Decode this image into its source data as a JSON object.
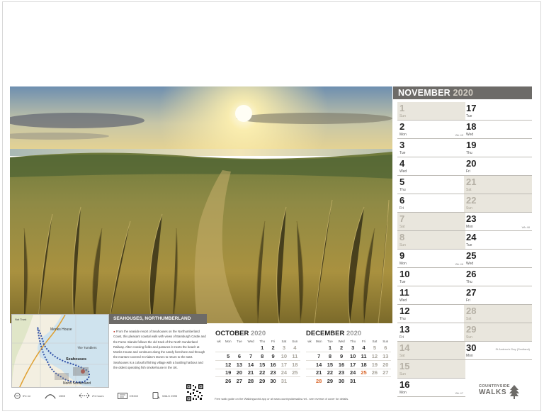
{
  "header": {
    "month": "NOVEMBER",
    "year": "2020"
  },
  "days_left": [
    {
      "num": "1",
      "name": "Sun",
      "weekend": true,
      "wk": ""
    },
    {
      "num": "2",
      "name": "Mon",
      "weekend": false,
      "wk": "Wk 45"
    },
    {
      "num": "3",
      "name": "Tue",
      "weekend": false,
      "wk": ""
    },
    {
      "num": "4",
      "name": "Wed",
      "weekend": false,
      "wk": ""
    },
    {
      "num": "5",
      "name": "Thu",
      "weekend": false,
      "wk": ""
    },
    {
      "num": "6",
      "name": "Fri",
      "weekend": false,
      "wk": ""
    },
    {
      "num": "7",
      "name": "Sat",
      "weekend": true,
      "wk": ""
    },
    {
      "num": "8",
      "name": "Sun",
      "weekend": true,
      "wk": ""
    },
    {
      "num": "9",
      "name": "Mon",
      "weekend": false,
      "wk": "Wk 46"
    },
    {
      "num": "10",
      "name": "Tue",
      "weekend": false,
      "wk": ""
    },
    {
      "num": "11",
      "name": "Wed",
      "weekend": false,
      "wk": ""
    },
    {
      "num": "12",
      "name": "Thu",
      "weekend": false,
      "wk": ""
    },
    {
      "num": "13",
      "name": "Fri",
      "weekend": false,
      "wk": ""
    },
    {
      "num": "14",
      "name": "Sat",
      "weekend": true,
      "wk": ""
    },
    {
      "num": "15",
      "name": "Sun",
      "weekend": true,
      "wk": ""
    },
    {
      "num": "16",
      "name": "Mon",
      "weekend": false,
      "wk": "Wk 47"
    }
  ],
  "days_right": [
    {
      "num": "17",
      "name": "Tue",
      "weekend": false,
      "wk": ""
    },
    {
      "num": "18",
      "name": "Wed",
      "weekend": false,
      "wk": ""
    },
    {
      "num": "19",
      "name": "Thu",
      "weekend": false,
      "wk": ""
    },
    {
      "num": "20",
      "name": "Fri",
      "weekend": false,
      "wk": ""
    },
    {
      "num": "21",
      "name": "Sat",
      "weekend": true,
      "wk": ""
    },
    {
      "num": "22",
      "name": "Sun",
      "weekend": true,
      "wk": ""
    },
    {
      "num": "23",
      "name": "Mon",
      "weekend": false,
      "wk": "Wk 48"
    },
    {
      "num": "24",
      "name": "Tue",
      "weekend": false,
      "wk": ""
    },
    {
      "num": "25",
      "name": "Wed",
      "weekend": false,
      "wk": ""
    },
    {
      "num": "26",
      "name": "Thu",
      "weekend": false,
      "wk": ""
    },
    {
      "num": "27",
      "name": "Fri",
      "weekend": false,
      "wk": ""
    },
    {
      "num": "28",
      "name": "Sat",
      "weekend": true,
      "wk": ""
    },
    {
      "num": "29",
      "name": "Sun",
      "weekend": true,
      "wk": ""
    },
    {
      "num": "30",
      "name": "Mon",
      "weekend": false,
      "wk": "",
      "note": "St Andrew's Day (Scotland)"
    }
  ],
  "caption": {
    "title": "SEAHOUSES, NORTHUMBERLAND",
    "text": "From the seaside resort of Seahouses on the Northumberland Coast, this pleasant coastal walk with views of Bamburgh Castle and the Farne Islands follows the old track of the North Sunderland Railway. After crossing fields and pastures it meets the beach at Monks House and continues along the sandy foreshore and through the marram-covered St Aidan's Dunes to return to the start. Seahouses is a colourful fishing village with a bustling harbour and the oldest operating fish smokehouse in the UK."
  },
  "weekday_headers": [
    "wk",
    "Mon",
    "Tue",
    "Wed",
    "Thu",
    "Fri",
    "Sat",
    "Sun"
  ],
  "october": {
    "month": "OCTOBER",
    "year": "2020",
    "rows": [
      [
        "",
        "",
        "",
        "",
        "1",
        "2",
        "3",
        "4"
      ],
      [
        "",
        "5",
        "6",
        "7",
        "8",
        "9",
        "10",
        "11"
      ],
      [
        "",
        "12",
        "13",
        "14",
        "15",
        "16",
        "17",
        "18"
      ],
      [
        "",
        "19",
        "20",
        "21",
        "22",
        "23",
        "24",
        "25"
      ],
      [
        "",
        "26",
        "27",
        "28",
        "29",
        "30",
        "31",
        ""
      ]
    ]
  },
  "december": {
    "month": "DECEMBER",
    "year": "2020",
    "rows": [
      [
        "",
        "",
        "1",
        "2",
        "3",
        "4",
        "5",
        "6"
      ],
      [
        "",
        "7",
        "8",
        "9",
        "10",
        "11",
        "12",
        "13"
      ],
      [
        "",
        "14",
        "15",
        "16",
        "17",
        "18",
        "19",
        "20"
      ],
      [
        "",
        "21",
        "22",
        "23",
        "24",
        "25",
        "26",
        "27"
      ],
      [
        "",
        "28",
        "29",
        "30",
        "31",
        "",
        "",
        ""
      ]
    ],
    "highlight": [
      "25",
      "28"
    ]
  },
  "footer": {
    "icons": [
      {
        "name": "distance-icon",
        "label": "5½ mi"
      },
      {
        "name": "ascent-icon",
        "label": "155ft"
      },
      {
        "name": "time-icon",
        "label": "2½ hours"
      },
      {
        "name": "map-icon",
        "label": "OS340"
      },
      {
        "name": "walk-code-icon",
        "label": "WALK 2595"
      }
    ],
    "note": "Free walk guide on the Walkingworld app or at www.countrysidewalks.net - see reverse of cover for details."
  },
  "map_labels": [
    "Monks House",
    "Seahouses",
    "The Tumblers",
    "North Sunderland",
    "Nat Trust"
  ],
  "logo": {
    "line1": "COUNTRYSIDE",
    "line2": "WALKS"
  },
  "colors": {
    "band": "#6d6b68",
    "weekend": "#e9e6dd",
    "holiday": "#d9672b"
  }
}
